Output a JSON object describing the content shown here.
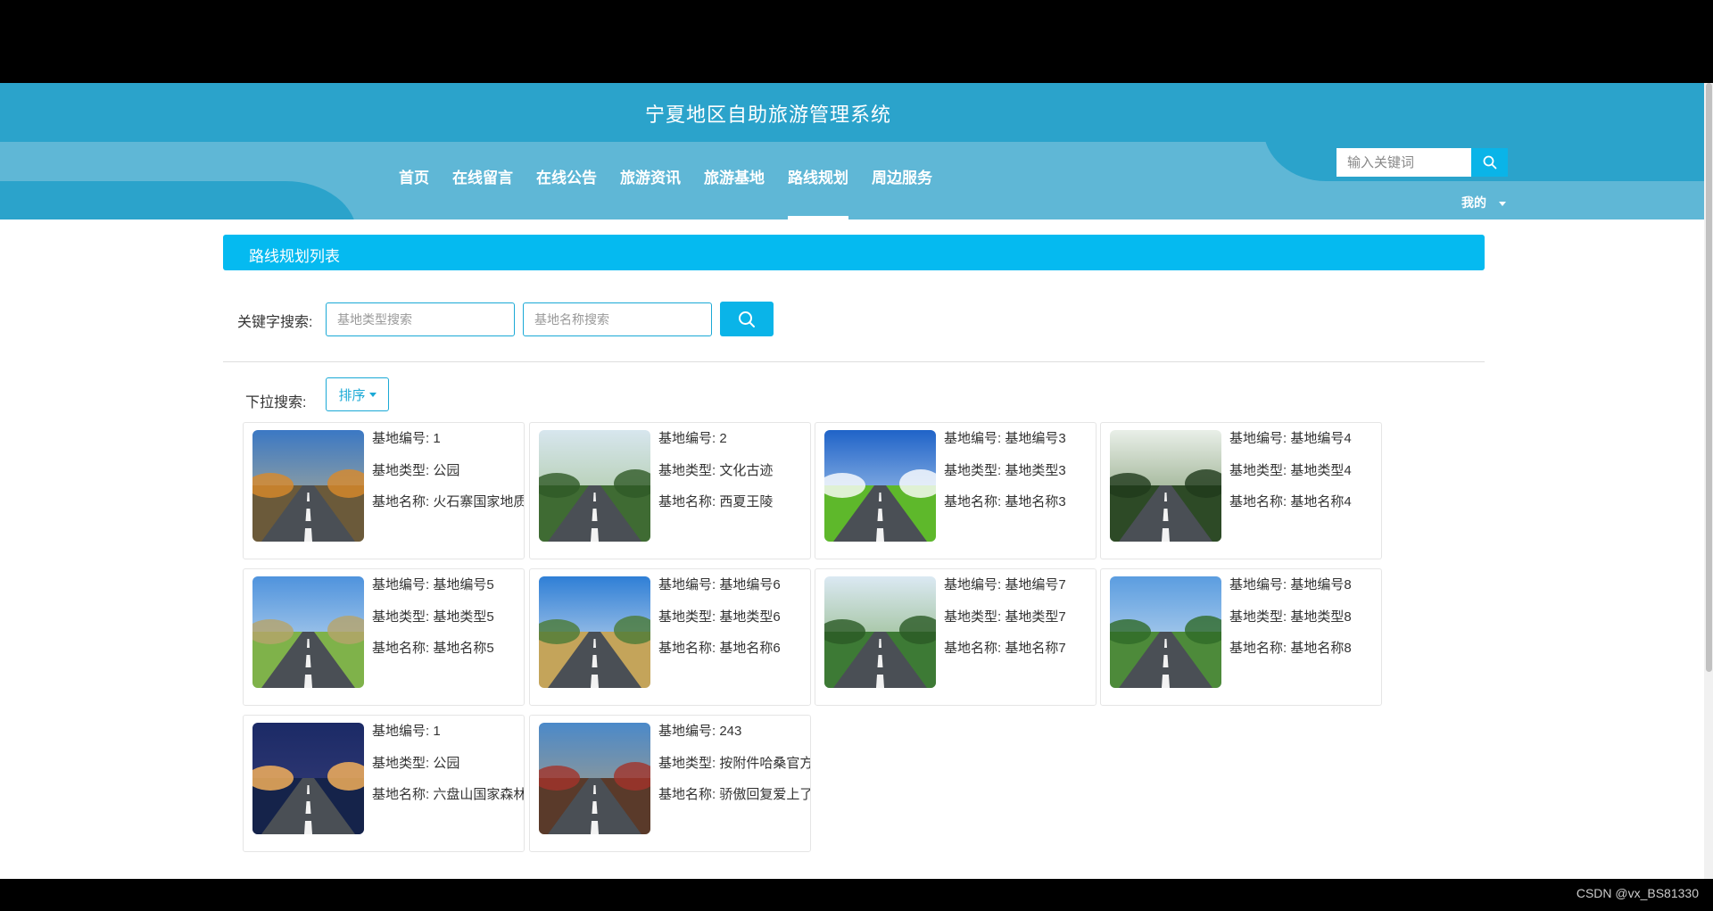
{
  "header": {
    "site_title": "宁夏地区自助旅游管理系统",
    "nav": [
      {
        "label": "首页"
      },
      {
        "label": "在线留言"
      },
      {
        "label": "在线公告"
      },
      {
        "label": "旅游资讯"
      },
      {
        "label": "旅游基地"
      },
      {
        "label": "路线规划",
        "active": true
      },
      {
        "label": "周边服务"
      }
    ],
    "search_placeholder": "输入关键词",
    "user_menu": "我的"
  },
  "main": {
    "section_title": "路线规划列表",
    "keyword_label": "关键字搜索:",
    "type_placeholder": "基地类型搜索",
    "name_placeholder": "基地名称搜索",
    "dropdown_label": "下拉搜索:",
    "sort_label": "排序"
  },
  "cards": [
    {
      "number": "基地编号: 1",
      "type": "基地类型: 公园",
      "name": "基地名称: 火石寨国家地质公园",
      "scene": "autumn"
    },
    {
      "number": "基地编号: 2",
      "type": "基地类型: 文化古迹",
      "name": "基地名称: 西夏王陵",
      "scene": "green"
    },
    {
      "number": "基地编号: 基地编号3",
      "type": "基地类型: 基地类型3",
      "name": "基地名称: 基地名称3",
      "scene": "sky"
    },
    {
      "number": "基地编号: 基地编号4",
      "type": "基地类型: 基地类型4",
      "name": "基地名称: 基地名称4",
      "scene": "forest"
    },
    {
      "number": "基地编号: 基地编号5",
      "type": "基地类型: 基地类型5",
      "name": "基地名称: 基地名称5",
      "scene": "hills"
    },
    {
      "number": "基地编号: 基地编号6",
      "type": "基地类型: 基地类型6",
      "name": "基地名称: 基地名称6",
      "scene": "field"
    },
    {
      "number": "基地编号: 基地编号7",
      "type": "基地类型: 基地类型7",
      "name": "基地名称: 基地名称7",
      "scene": "trees"
    },
    {
      "number": "基地编号: 基地编号8",
      "type": "基地类型: 基地类型8",
      "name": "基地名称: 基地名称8",
      "scene": "valley"
    },
    {
      "number": "基地编号: 1",
      "type": "基地类型: 公园",
      "name": "基地名称: 六盘山国家森林公园",
      "scene": "night"
    },
    {
      "number": "基地编号: 243",
      "type": "基地类型: 按附件哈桑官方",
      "name": "基地名称: 骄傲回复爱上了",
      "scene": "town"
    }
  ],
  "footer": {
    "credit": "CSDN @vx_BS81330"
  },
  "colors": {
    "header_dark": "#2ba3cb",
    "header_light": "#5fb7d6",
    "accent": "#05baf0",
    "button": "#0ab4e8"
  }
}
